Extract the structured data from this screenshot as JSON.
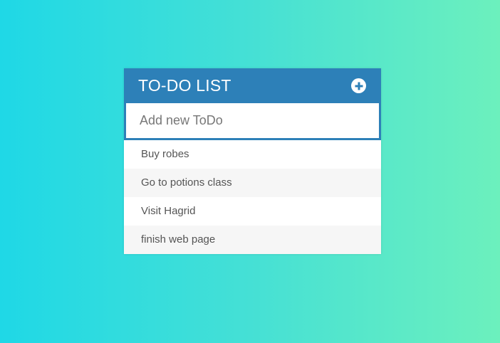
{
  "colors": {
    "header": "#2d80b8",
    "background_left": "#1fd8e6",
    "background_right": "#6cf0bd"
  },
  "header": {
    "title": "TO-DO LIST",
    "add_icon": "plus-circle-icon"
  },
  "input": {
    "placeholder": "Add new ToDo",
    "value": ""
  },
  "todos": [
    {
      "label": "Buy robes"
    },
    {
      "label": "Go to potions class"
    },
    {
      "label": "Visit Hagrid"
    },
    {
      "label": "finish web page"
    }
  ]
}
